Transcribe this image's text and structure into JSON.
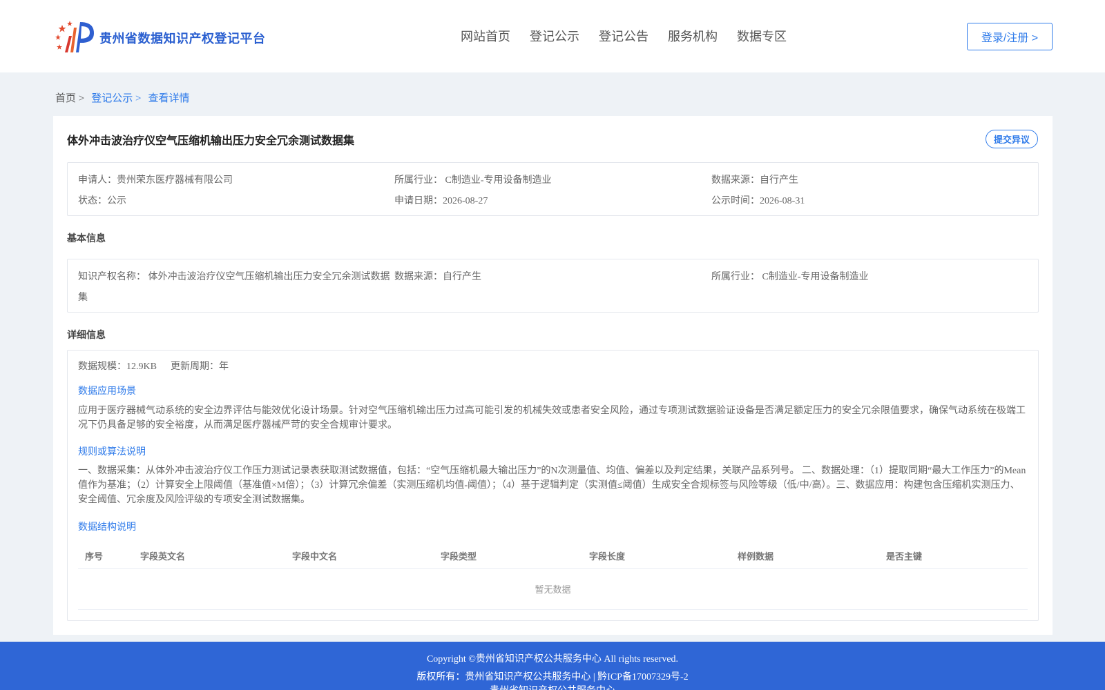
{
  "header": {
    "brand": "贵州省数据知识产权登记平台",
    "nav": [
      "网站首页",
      "登记公示",
      "登记公告",
      "服务机构",
      "数据专区"
    ],
    "login": "登录/注册 >"
  },
  "breadcrumb": {
    "home": "首页 >",
    "section": "登记公示 >",
    "current": "查看详情"
  },
  "record": {
    "title": "体外冲击波治疗仪空气压缩机输出压力安全冗余测试数据集",
    "objection_button": "提交异议",
    "summary": {
      "applicant": "申请人：贵州荣东医疗器械有限公司",
      "industry": "所属行业： C制造业-专用设备制造业",
      "source": "数据来源：自行产生",
      "status": "状态：公示",
      "apply_date": "申请日期：2026-08-27",
      "publish_date": "公示时间：2026-08-31"
    },
    "basic_title": "基本信息",
    "basic": {
      "ip_name_line1": "知识产权名称： 体外冲击波治疗仪空气压缩机输出压力安全冗余测试数据",
      "ip_name_line2": "集",
      "source": "数据来源：自行产生",
      "industry": "所属行业： C制造业-专用设备制造业"
    },
    "detail_title": "详细信息",
    "detail": {
      "scale": "数据规模：12.9KB",
      "cycle": "更新周期：年",
      "scene_label": "数据应用场景",
      "scene_text": "应用于医疗器械气动系统的安全边界评估与能效优化设计场景。针对空气压缩机输出压力过高可能引发的机械失效或患者安全风险，通过专项测试数据验证设备是否满足额定压力的安全冗余限值要求，确保气动系统在极端工况下仍具备足够的安全裕度，从而满足医疗器械严苛的安全合规审计要求。",
      "rule_label": "规则或算法说明",
      "rule_text": "一、数据采集：从体外冲击波治疗仪工作压力测试记录表获取测试数据值，包括：“空气压缩机最大输出压力”的N次测量值、均值、偏差以及判定结果，关联产品系列号。 二、数据处理：（1）提取同期“最大工作压力”的Mean值作为基准；（2）计算安全上限阈值（基准值×M倍）；（3）计算冗余偏差（实测压缩机均值-阈值）；（4）基于逻辑判定（实测值≤阈值）生成安全合规标签与风险等级（低/中/高）。三、数据应用：构建包含压缩机实测压力、安全阈值、冗余度及风险评级的专项安全测试数据集。",
      "structure_label": "数据结构说明",
      "table_headers": [
        "序号",
        "字段英文名",
        "字段中文名",
        "字段类型",
        "字段长度",
        "样例数据",
        "是否主键"
      ],
      "empty": "暂无数据"
    }
  },
  "footer": {
    "copyright": "Copyright ©贵州省知识产权公共服务中心 All rights reserved.",
    "owner": "版权所有：贵州省知识产权公共服务中心 | 黔ICP备17007329号-2",
    "host": "贵州省知识产权公共服务中心"
  },
  "colors": {
    "primary": "#2f7bea",
    "brand": "#2a5fd0",
    "footer": "#2f66d6",
    "logo_red": "#d8372f",
    "logo_blue": "#2f5fd0"
  },
  "icons": {
    "logo": "ip-platform-logo-icon"
  }
}
